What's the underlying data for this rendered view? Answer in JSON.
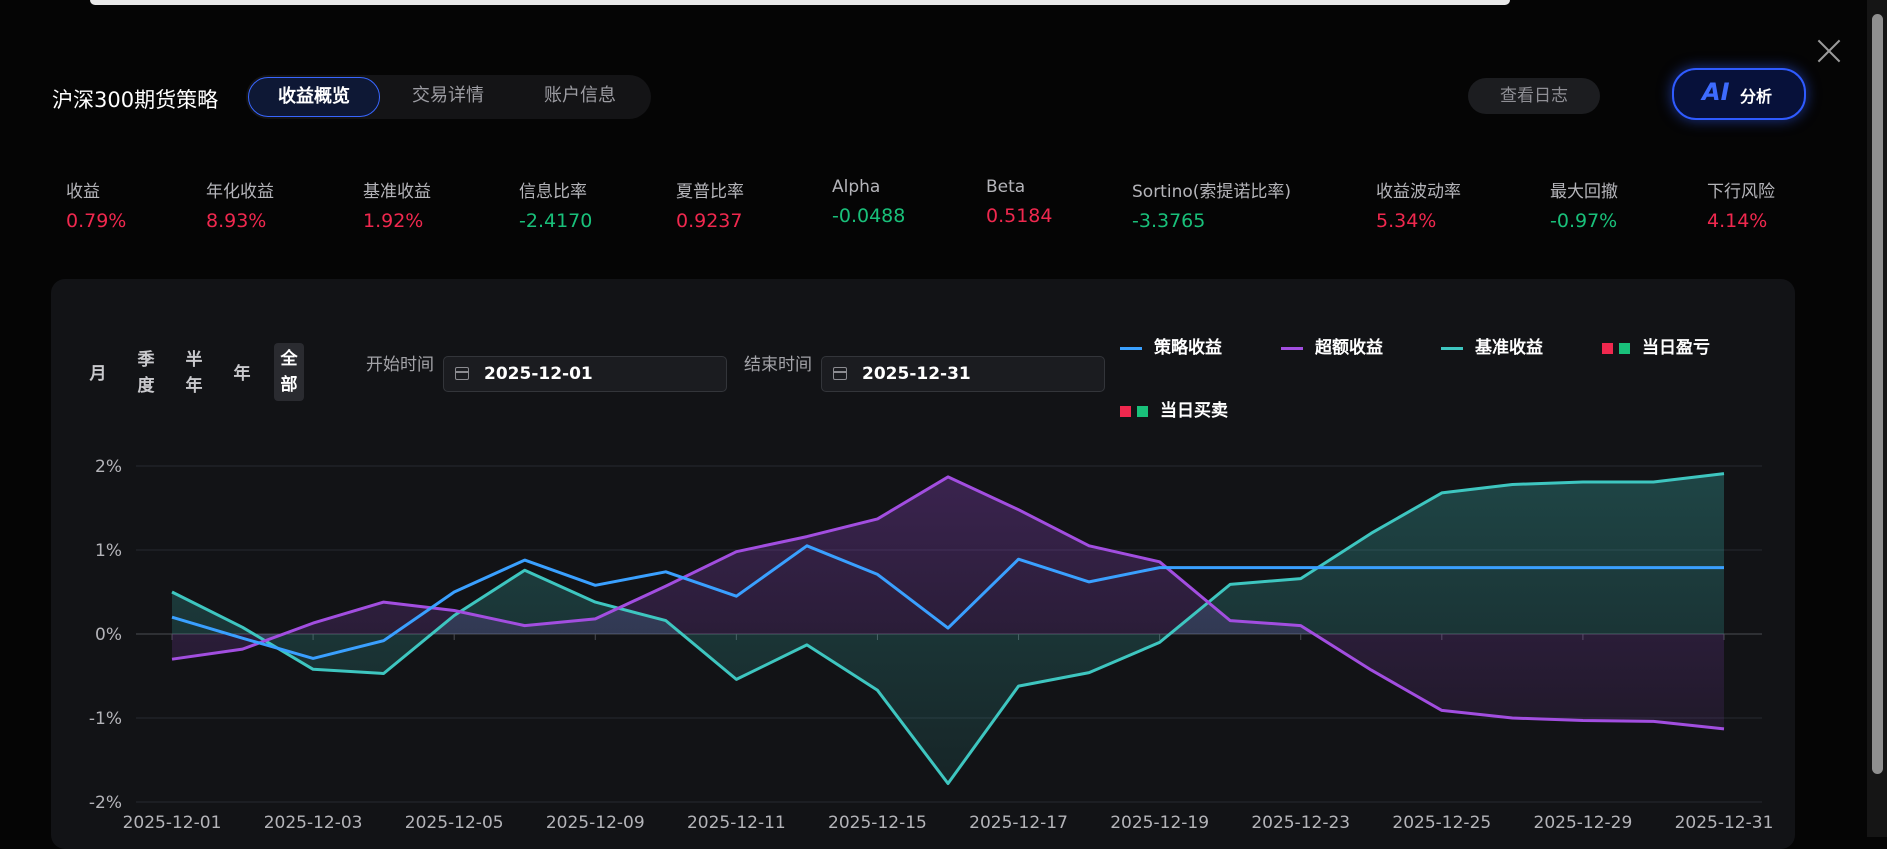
{
  "header": {
    "title": "沪深300期货策略",
    "tabs": [
      {
        "label": "收益概览",
        "active": true
      },
      {
        "label": "交易详情",
        "active": false
      },
      {
        "label": "账户信息",
        "active": false
      }
    ],
    "log_button": "查看日志",
    "ai_button": {
      "logo": "AI",
      "label": "分析"
    }
  },
  "metrics": [
    {
      "label": "收益",
      "value": "0.79%",
      "trend": "pos"
    },
    {
      "label": "年化收益",
      "value": "8.93%",
      "trend": "pos"
    },
    {
      "label": "基准收益",
      "value": "1.92%",
      "trend": "pos"
    },
    {
      "label": "信息比率",
      "value": "-2.4170",
      "trend": "neg"
    },
    {
      "label": "夏普比率",
      "value": "0.9237",
      "trend": "pos"
    },
    {
      "label": "Alpha",
      "value": "-0.0488",
      "trend": "neg"
    },
    {
      "label": "Beta",
      "value": "0.5184",
      "trend": "pos"
    },
    {
      "label": "Sortino(索提诺比率)",
      "value": "-3.3765",
      "trend": "neg"
    },
    {
      "label": "收益波动率",
      "value": "5.34%",
      "trend": "pos"
    },
    {
      "label": "最大回撤",
      "value": "-0.97%",
      "trend": "neg"
    },
    {
      "label": "下行风险",
      "value": "4.14%",
      "trend": "pos"
    }
  ],
  "filters": {
    "periods": [
      {
        "label": "月",
        "active": false
      },
      {
        "label": "季度",
        "active": false
      },
      {
        "label": "半年",
        "active": false
      },
      {
        "label": "年",
        "active": false
      },
      {
        "label": "全部",
        "active": true
      }
    ],
    "start_label": "开始时间",
    "start_date": "2025-12-01",
    "end_label": "结束时间",
    "end_date": "2025-12-31"
  },
  "colors": {
    "strategy": "#3aa0ff",
    "excess": "#a24ee0",
    "benchmark": "#3ec6c0",
    "up": "#f0284e",
    "down": "#19c07a"
  },
  "chart_data": {
    "type": "line",
    "legend": [
      "策略收益",
      "超额收益",
      "基准收益",
      "当日盈亏",
      "当日买卖"
    ],
    "y_ticks": [
      "2%",
      "1%",
      "0%",
      "-1%",
      "-2%"
    ],
    "ylim": [
      -2,
      2
    ],
    "x_tick_labels": [
      "2025-12-01",
      "2025-12-03",
      "2025-12-05",
      "2025-12-09",
      "2025-12-11",
      "2025-12-15",
      "2025-12-17",
      "2025-12-19",
      "2025-12-23",
      "2025-12-25",
      "2025-12-29",
      "2025-12-31"
    ],
    "x": [
      "2025-12-01",
      "2025-12-02",
      "2025-12-03",
      "2025-12-04",
      "2025-12-05",
      "2025-12-08",
      "2025-12-09",
      "2025-12-10",
      "2025-12-11",
      "2025-12-12",
      "2025-12-15",
      "2025-12-16",
      "2025-12-17",
      "2025-12-18",
      "2025-12-19",
      "2025-12-22",
      "2025-12-23",
      "2025-12-24",
      "2025-12-25",
      "2025-12-26",
      "2025-12-29",
      "2025-12-30",
      "2025-12-31"
    ],
    "series": [
      {
        "name": "策略收益",
        "values": [
          0.2,
          -0.05,
          -0.29,
          -0.08,
          0.5,
          0.88,
          0.58,
          0.74,
          0.45,
          1.05,
          0.71,
          0.07,
          0.89,
          0.62,
          0.79,
          0.79,
          0.79,
          0.79,
          0.79,
          0.79,
          0.79,
          0.79,
          0.79
        ]
      },
      {
        "name": "超额收益",
        "values": [
          -0.3,
          -0.18,
          0.13,
          0.38,
          0.28,
          0.1,
          0.18,
          0.57,
          0.98,
          1.16,
          1.37,
          1.87,
          1.48,
          1.05,
          0.86,
          0.16,
          0.1,
          -0.43,
          -0.91,
          -1.0,
          -1.03,
          -1.04,
          -1.13
        ]
      },
      {
        "name": "基准收益",
        "values": [
          0.5,
          0.08,
          -0.42,
          -0.47,
          0.22,
          0.76,
          0.38,
          0.16,
          -0.54,
          -0.13,
          -0.67,
          -1.78,
          -0.62,
          -0.46,
          -0.1,
          0.59,
          0.66,
          1.2,
          1.68,
          1.78,
          1.81,
          1.81,
          1.91
        ]
      }
    ]
  }
}
